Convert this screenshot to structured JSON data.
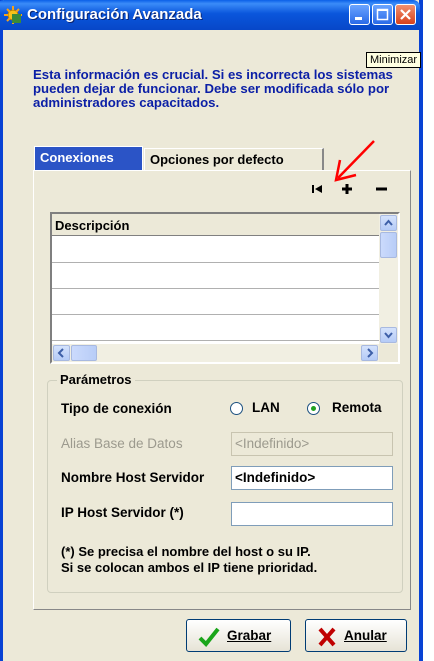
{
  "window": {
    "title": "Configuración Avanzada"
  },
  "tooltip": "Minimizar",
  "warning_text": "Esta información es crucial. Si es incorrecta  los sistemas pueden dejar de funcionar. Debe ser modificada sólo por administradores capacitados.",
  "tabs": [
    {
      "label": "Conexiones",
      "active": true
    },
    {
      "label": "Opciones por defecto",
      "active": false
    }
  ],
  "nav_buttons": [
    "first-record-icon",
    "plus-icon",
    "minus-icon"
  ],
  "grid": {
    "column_header": "Descripción",
    "rows": [
      "",
      "",
      "",
      ""
    ]
  },
  "parametros": {
    "label": "Parámetros",
    "tipo_conexion": {
      "label": "Tipo de conexión",
      "options": [
        {
          "label": "LAN",
          "selected": false
        },
        {
          "label": "Remota",
          "selected": true
        }
      ]
    },
    "alias": {
      "label": "Alias Base de Datos",
      "value": "<Indefinido>"
    },
    "nombre_host": {
      "label": "Nombre Host Servidor",
      "value": "<Indefinido>"
    },
    "ip_host": {
      "label": "IP Host Servidor (*)",
      "value": ""
    },
    "note_line1": "(*) Se precisa el nombre del host o su IP.",
    "note_line2": "Si se colocan ambos el IP tiene prioridad."
  },
  "buttons": {
    "grabar": "Grabar",
    "anular": "Anular"
  },
  "colors": {
    "titlebar": "#0a56dc",
    "warning_text": "#0b1fa6",
    "active_tab": "#2b54c6",
    "annotation_arrow": "#ff0000",
    "ok_check": "#1aa51a",
    "cancel_x": "#c00000"
  }
}
